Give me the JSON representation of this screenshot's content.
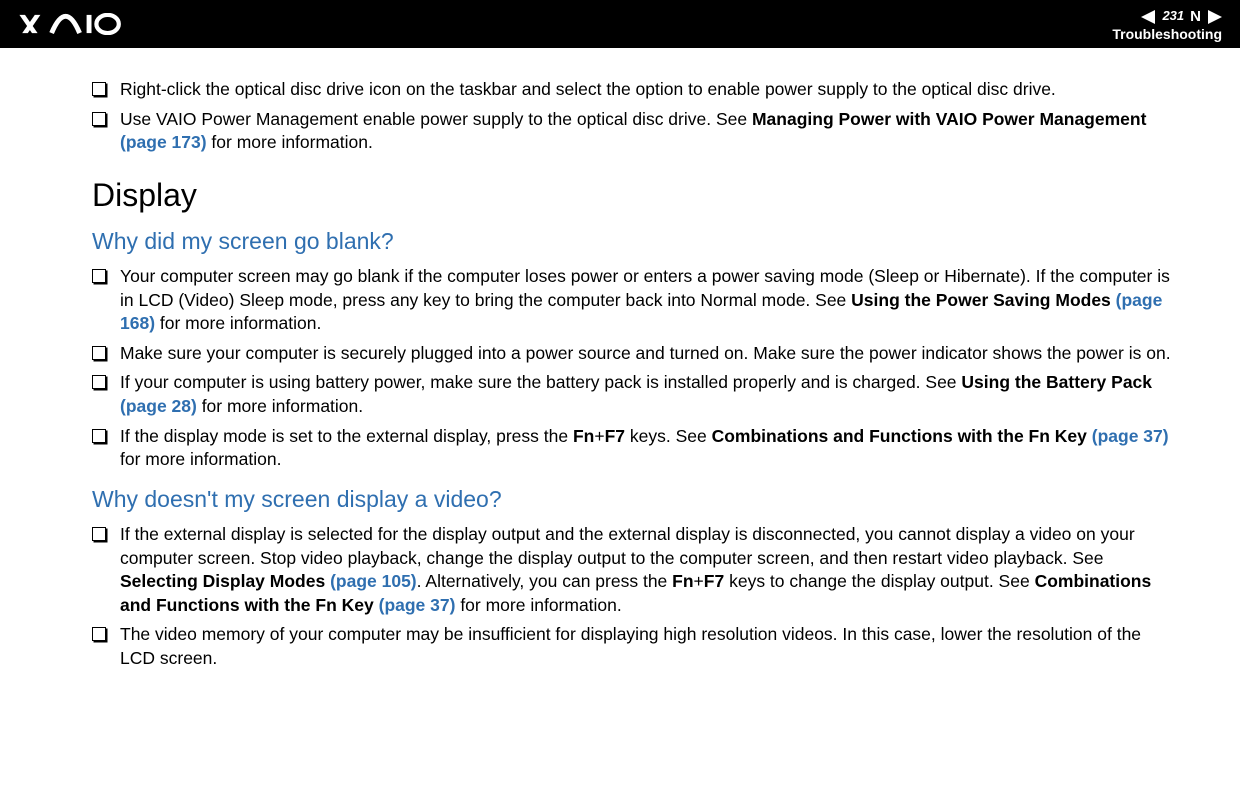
{
  "header": {
    "page_number": "231",
    "n_marker": "N",
    "section": "Troubleshooting"
  },
  "intro_bullets": [
    {
      "text": "Right-click the optical disc drive icon on the taskbar and select the option to enable power supply to the optical disc drive."
    },
    {
      "prefix": "Use VAIO Power Management enable power supply to the optical disc drive. See ",
      "bold1": "Managing Power with VAIO Power Management",
      "link": " (page 173)",
      "suffix": " for more information."
    }
  ],
  "section_title": "Display",
  "qa": [
    {
      "question": "Why did my screen go blank?",
      "bullets": [
        {
          "prefix": "Your computer screen may go blank if the computer loses power or enters a power saving mode (Sleep or Hibernate). If the computer is in LCD (Video) Sleep mode, press any key to bring the computer back into Normal mode. See ",
          "bold1": "Using the Power Saving Modes",
          "link": " (page 168)",
          "suffix": " for more information."
        },
        {
          "text": "Make sure your computer is securely plugged into a power source and turned on. Make sure the power indicator shows the power is on."
        },
        {
          "prefix": "If your computer is using battery power, make sure the battery pack is installed properly and is charged. See ",
          "bold1": "Using the Battery Pack",
          "link": " (page 28)",
          "suffix": " for more information."
        },
        {
          "prefix": "If the display mode is set to the external display, press the ",
          "bold_a": "Fn",
          "mid_a": "+",
          "bold_b": "F7",
          "mid_b": " keys. See ",
          "bold1": "Combinations and Functions with the Fn Key",
          "link": " (page 37)",
          "suffix": " for more information."
        }
      ]
    },
    {
      "question": "Why doesn't my screen display a video?",
      "bullets": [
        {
          "prefix": "If the external display is selected for the display output and the external display is disconnected, you cannot display a video on your computer screen. Stop video playback, change the display output to the computer screen, and then restart video playback. See ",
          "bold1": "Selecting Display Modes",
          "link": " (page 105)",
          "mid": ". Alternatively, you can press the ",
          "bold_a": "Fn",
          "mid_a": "+",
          "bold_b": "F7",
          "mid_b": " keys to change the display output. See ",
          "bold2": "Combinations and Functions with the Fn Key",
          "link2": " (page 37)",
          "suffix": " for more information."
        },
        {
          "text": "The video memory of your computer may be insufficient for displaying high resolution videos. In this case, lower the resolution of the LCD screen."
        }
      ]
    }
  ]
}
